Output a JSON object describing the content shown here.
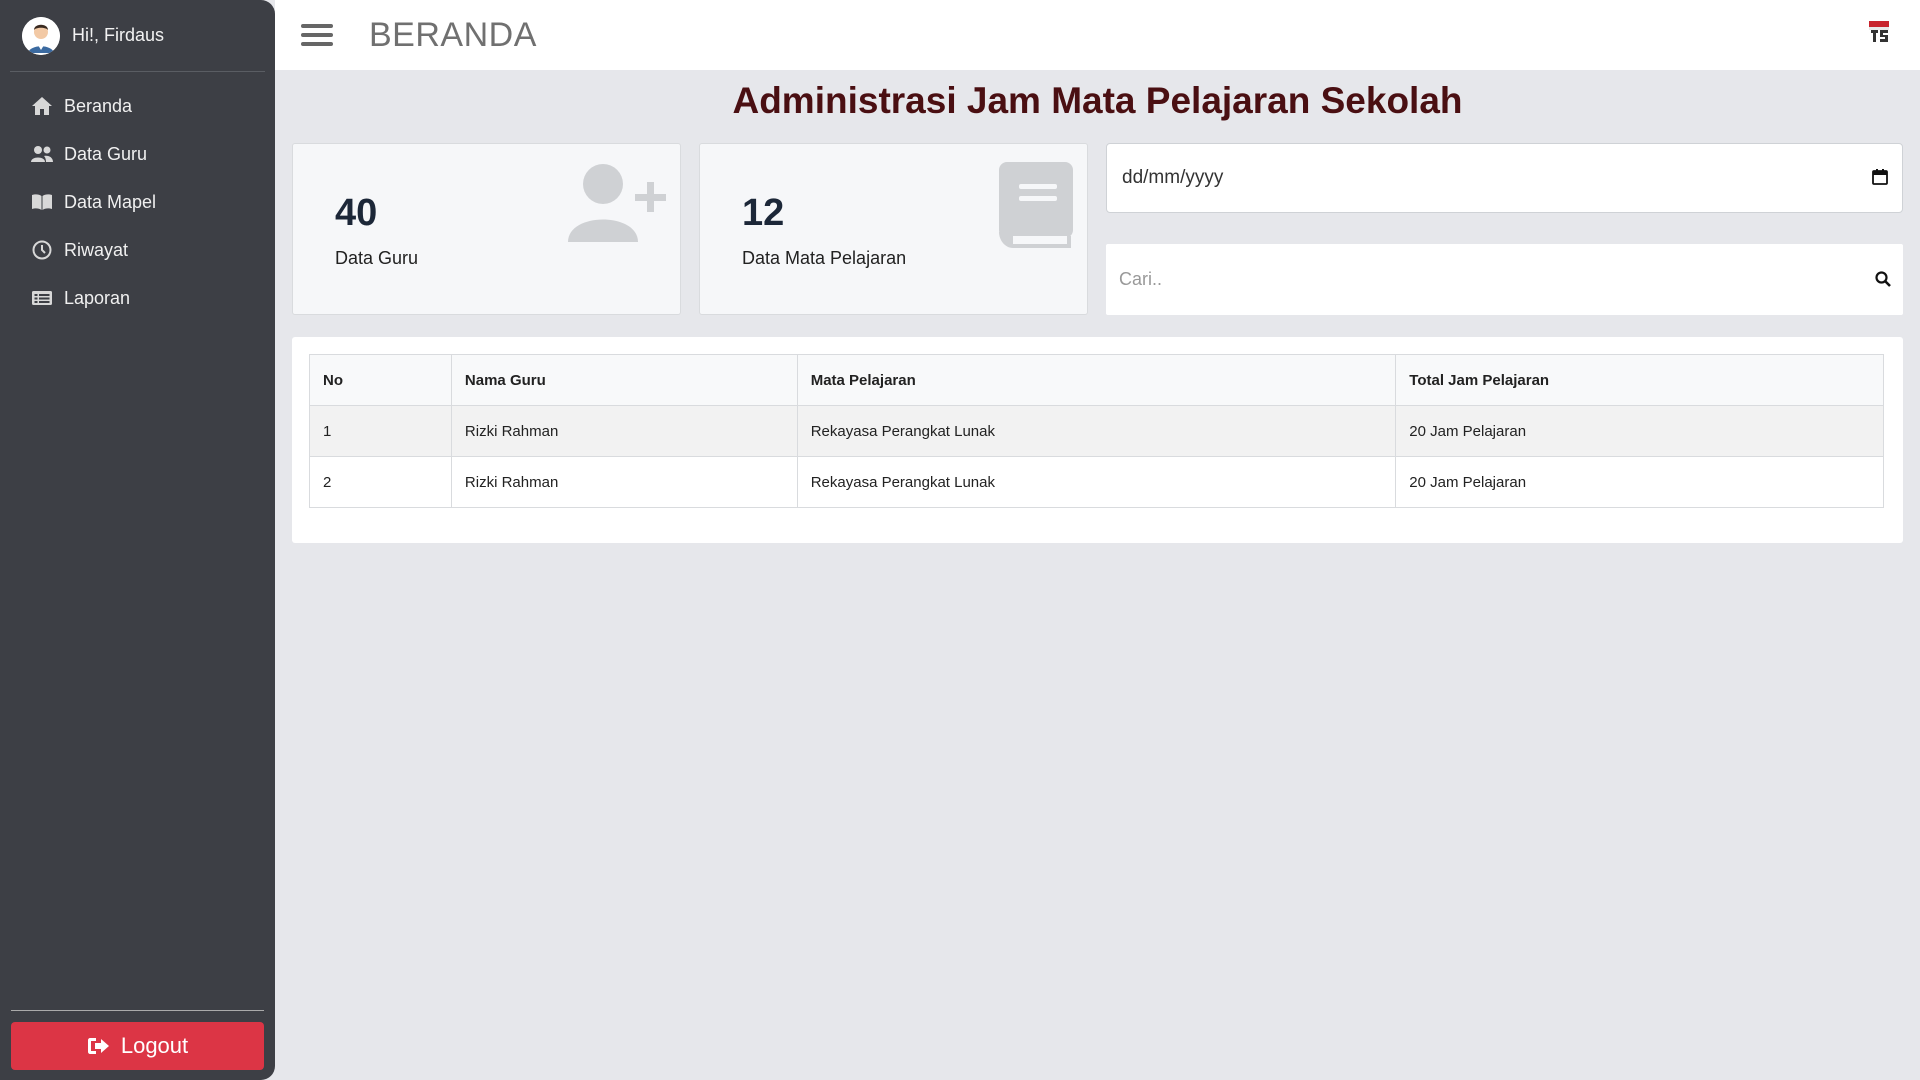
{
  "user": {
    "greeting": "Hi!, Firdaus"
  },
  "sidebar": {
    "items": [
      {
        "label": "Beranda",
        "icon": "home-icon"
      },
      {
        "label": "Data Guru",
        "icon": "users-icon"
      },
      {
        "label": "Data Mapel",
        "icon": "book-open-icon"
      },
      {
        "label": "Riwayat",
        "icon": "clock-icon"
      },
      {
        "label": "Laporan",
        "icon": "list-icon"
      }
    ],
    "logout_label": "Logout"
  },
  "header": {
    "title": "BERANDA"
  },
  "main": {
    "title": "Administrasi Jam Mata Pelajaran Sekolah",
    "cards": [
      {
        "value": "40",
        "label": "Data Guru",
        "icon": "user-plus-icon"
      },
      {
        "value": "12",
        "label": "Data Mata Pelajaran",
        "icon": "book-icon"
      }
    ],
    "date_placeholder": "dd/mm/yyyy",
    "search_placeholder": "Cari.."
  },
  "table": {
    "headers": [
      "No",
      "Nama Guru",
      "Mata Pelajaran",
      "Total Jam Pelajaran"
    ],
    "rows": [
      [
        "1",
        "Rizki Rahman",
        "Rekayasa Perangkat Lunak",
        "20 Jam Pelajaran"
      ],
      [
        "2",
        "Rizki Rahman",
        "Rekayasa Perangkat Lunak",
        "20 Jam Pelajaran"
      ]
    ]
  },
  "colors": {
    "accent": "#dc3545",
    "title": "#4a0f12",
    "sidebar": "#3d3f45"
  }
}
